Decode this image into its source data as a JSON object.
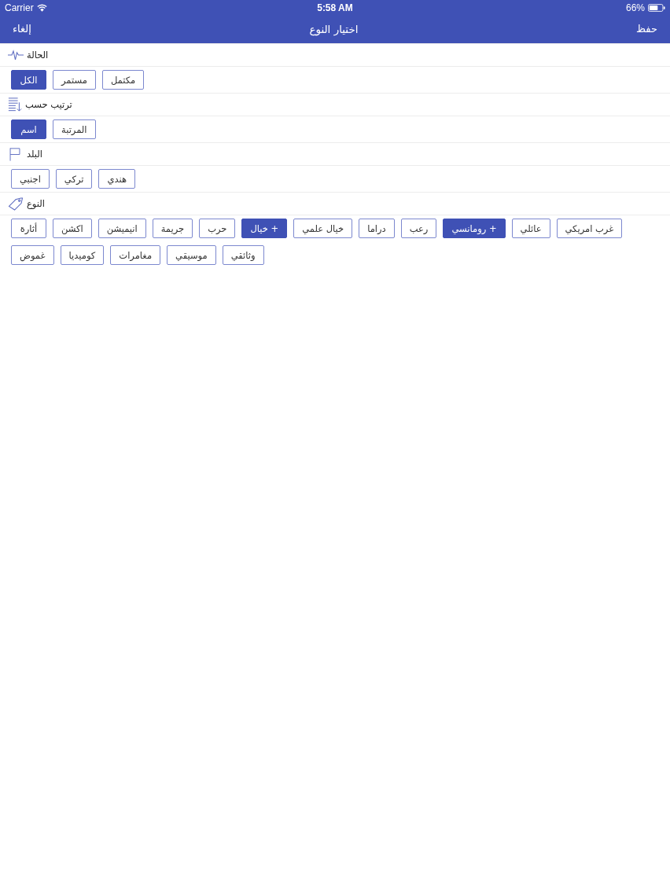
{
  "status_bar": {
    "carrier": "Carrier",
    "time": "5:58 AM",
    "battery": "66%"
  },
  "nav_bar": {
    "cancel": "إلغاء",
    "title": "اختيار النوع",
    "save": "حفظ"
  },
  "sections": [
    {
      "title": "الحالة",
      "kind": "pulse",
      "options": [
        {
          "label": "مكتمل",
          "selected": false
        },
        {
          "label": "مستمر",
          "selected": false
        },
        {
          "label": "الكل",
          "selected": true
        }
      ]
    },
    {
      "title": "ترتيب حسب",
      "kind": "sort",
      "options": [
        {
          "label": "المرتبة",
          "selected": false
        },
        {
          "label": "اسم",
          "selected": true
        }
      ]
    },
    {
      "title": "البلد",
      "kind": "flag",
      "options": [
        {
          "label": "هندي",
          "selected": false
        },
        {
          "label": "تركي",
          "selected": false
        },
        {
          "label": "اجنبي",
          "selected": false
        }
      ]
    },
    {
      "title": "النوع",
      "kind": "tag",
      "options": [
        {
          "label": "غرب امريكي",
          "selected": false
        },
        {
          "label": "عائلي",
          "selected": false
        },
        {
          "label": "+ رومانسي",
          "selected": true
        },
        {
          "label": "رعب",
          "selected": false
        },
        {
          "label": "دراما",
          "selected": false
        },
        {
          "label": "خيال علمي",
          "selected": false
        },
        {
          "label": "+ خيال",
          "selected": true
        },
        {
          "label": "حرب",
          "selected": false
        },
        {
          "label": "جريمة",
          "selected": false
        },
        {
          "label": "انيميشن",
          "selected": false
        },
        {
          "label": "اكشن",
          "selected": false
        },
        {
          "label": "أثارة",
          "selected": false
        },
        {
          "label": "وثائقي",
          "selected": false
        },
        {
          "label": "موسيقي",
          "selected": false
        },
        {
          "label": "مغامرات",
          "selected": false
        },
        {
          "label": "كوميديا",
          "selected": false
        },
        {
          "label": "غموض",
          "selected": false
        }
      ]
    }
  ]
}
